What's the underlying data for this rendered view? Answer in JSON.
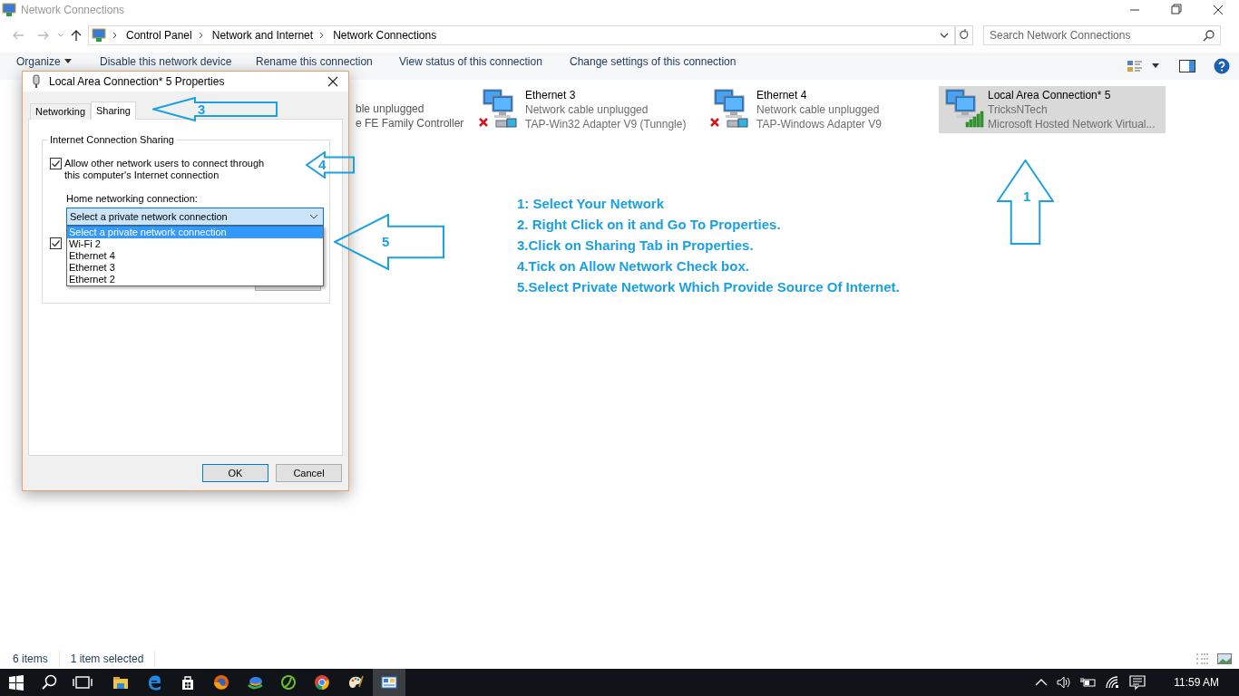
{
  "window": {
    "title": "Network Connections"
  },
  "address": {
    "breadcrumbs": [
      "Control Panel",
      "Network and Internet",
      "Network Connections"
    ],
    "search_placeholder": "Search Network Connections"
  },
  "command_bar": {
    "items": [
      {
        "label": "Organize",
        "dropdown": true
      },
      {
        "label": "Disable this network device",
        "dropdown": false
      },
      {
        "label": "Rename this connection",
        "dropdown": false
      },
      {
        "label": "View status of this connection",
        "dropdown": false
      },
      {
        "label": "Change settings of this connection",
        "dropdown": false
      }
    ]
  },
  "connections": [
    {
      "kind": "partial",
      "lines": [
        "ble unplugged",
        "e FE Family Controller"
      ],
      "selected": false
    },
    {
      "kind": "disconnected",
      "name": "Ethernet 3",
      "status": "Network cable unplugged",
      "device": "TAP-Win32 Adapter V9 (Tunngle)",
      "selected": false
    },
    {
      "kind": "disconnected",
      "name": "Ethernet 4",
      "status": "Network cable unplugged",
      "device": "TAP-Windows Adapter V9",
      "selected": false
    },
    {
      "kind": "wireless",
      "name": "Local Area Connection* 5",
      "status": "TricksNTech",
      "device": "Microsoft Hosted Network Virtual...",
      "selected": true
    }
  ],
  "dialog": {
    "title": "Local Area Connection* 5 Properties",
    "tabs": [
      {
        "label": "Networking",
        "selected": false
      },
      {
        "label": "Sharing",
        "selected": true
      }
    ],
    "group_title": "Internet Connection Sharing",
    "allow_checkbox": {
      "label": "Allow other network users to connect through this computer's Internet connection",
      "checked": true
    },
    "home_label": "Home networking connection:",
    "combo_value": "Select a private network connection",
    "options": [
      {
        "label": "Select a private network connection",
        "selected": true
      },
      {
        "label": "Wi-Fi 2",
        "selected": false
      },
      {
        "label": "Ethernet 4",
        "selected": false
      },
      {
        "label": "Ethernet 3",
        "selected": false
      },
      {
        "label": "Ethernet 2",
        "selected": false
      }
    ],
    "control_checkbox": {
      "checked": true
    },
    "buttons": [
      "OK",
      "Cancel"
    ]
  },
  "annotations": {
    "arrows": [
      {
        "number": "3"
      },
      {
        "number": "4"
      },
      {
        "number": "5"
      },
      {
        "number": "1"
      }
    ],
    "instructions": [
      "1: Select Your Network",
      "2. Right Click on it and Go To Properties.",
      "3.Click on Sharing Tab in Properties.",
      "4.Tick on Allow Network Check box.",
      "5.Select Private Network Which Provide Source Of Internet."
    ]
  },
  "status_bar": [
    "6 items",
    "1 item selected"
  ],
  "taskbar": {
    "apps": [
      {
        "kind": "explorer",
        "selected": false
      },
      {
        "kind": "edge",
        "selected": false
      },
      {
        "kind": "store",
        "selected": false
      },
      {
        "kind": "firefox",
        "selected": false
      },
      {
        "kind": "idm",
        "selected": false
      },
      {
        "kind": "dreamweaver",
        "selected": false
      },
      {
        "kind": "chrome",
        "selected": false
      },
      {
        "kind": "paint",
        "selected": false
      },
      {
        "kind": "network",
        "selected": true
      }
    ],
    "time": "11:59 AM"
  }
}
